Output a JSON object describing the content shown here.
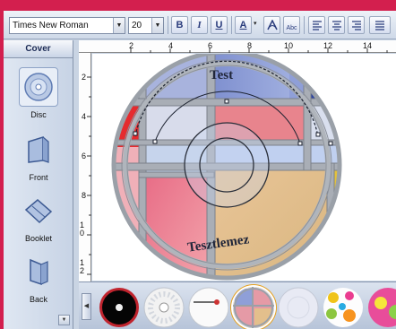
{
  "toolbar": {
    "font_name": "Times New Roman",
    "font_size": "20",
    "bold_label": "B",
    "italic_label": "I",
    "underline_label": "U",
    "color_label": "A",
    "abc_label": "Abc"
  },
  "sidebar": {
    "tab_label": "Cover",
    "items": [
      {
        "label": "Disc",
        "icon": "disc-icon",
        "selected": true
      },
      {
        "label": "Front",
        "icon": "front-cover-icon",
        "selected": false
      },
      {
        "label": "Booklet",
        "icon": "booklet-icon",
        "selected": false
      },
      {
        "label": "Back",
        "icon": "back-cover-icon",
        "selected": false
      }
    ]
  },
  "ruler": {
    "top_numbers": [
      "2",
      "4",
      "6",
      "8",
      "10",
      "12",
      "14"
    ],
    "left_numbers": [
      "2",
      "4",
      "6",
      "8",
      "10",
      "12"
    ]
  },
  "disc": {
    "top_text": "Test",
    "bottom_text": "Tesztlemez"
  },
  "templates": [
    {
      "icon": "black-disc-template"
    },
    {
      "icon": "flower-disc-template"
    },
    {
      "icon": "white-key-disc-template"
    },
    {
      "icon": "stained-glass-disc-template",
      "selected": true
    },
    {
      "icon": "plain-silver-disc-template"
    },
    {
      "icon": "colorful-dots-disc-template"
    },
    {
      "icon": "pink-yellow-disc-template"
    }
  ],
  "colors": {
    "outer_frame": "#d31f4e",
    "accent": "#2a3c7c"
  }
}
